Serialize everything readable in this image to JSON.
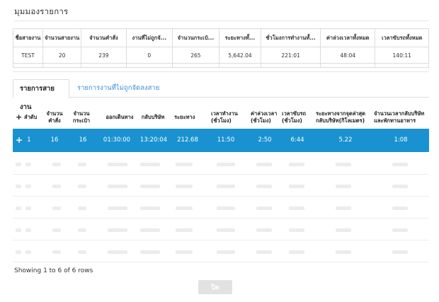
{
  "page": {
    "title": "มุมมองรายการ"
  },
  "summary": {
    "headers": [
      "ชื่อสายงาน",
      "จำนวนสายงาน",
      "จำนวนคำสั่ง",
      "งานที่ไม่ถูกจั...",
      "จำนวนกระเป๋...",
      "ระยะทางทั้...",
      "ชั่วโมงการทำงานทั้...",
      "ค่าล่วงเวลาทั้งหมด",
      "เวลาขับรถทั้งหมด"
    ],
    "values": [
      "TEST",
      "20",
      "239",
      "0",
      "265",
      "5,642.04",
      "221:01",
      "48:04",
      "140:11"
    ]
  },
  "tabs": [
    {
      "label": "รายการสายงาน",
      "active": true
    },
    {
      "label": "รายการงานที่ไม่ถูกจัดลงสาย",
      "active": false
    }
  ],
  "detail": {
    "headers": {
      "plus": "+",
      "seq": "ลำดับ",
      "orders_1": "จำนวน",
      "orders_2": "คำสั่ง",
      "bags_1": "จำนวน",
      "bags_2": "กระเป๋า",
      "depart": "ออกเดินทาง",
      "return": "กลับบริษัท",
      "distance": "ระยะทาง",
      "work_1": "เวลาทำงาน",
      "work_2": "(ชั่วโมง)",
      "ot_1": "ค่าล่วงเวลา",
      "ot_2": "(ชั่วโมง)",
      "drive_1": "เวลาขับรถ",
      "drive_2": "(ชั่วโมง)",
      "last_1": "ระยะทางจากจุดล่าสุด",
      "last_2": "กลับบริษัท(กิโลเมตร)",
      "back_1": "จำนวนเวลากลับบริษัท",
      "back_2": "และพักทานอาหาร"
    },
    "row": {
      "plus": "+",
      "seq": "1",
      "orders": "16",
      "bags": "16",
      "depart": "01:30:00",
      "return": "13:20:04",
      "distance": "212.68",
      "work": "11:50",
      "ot": "2:50",
      "drive": "6:44",
      "last_distance": "5.22",
      "back_time": "1:08"
    }
  },
  "footer": {
    "showing": "Showing 1 to 6 of 6 rows",
    "close_label": "ปิด"
  },
  "colors": {
    "selected_row": "#1a92d1",
    "tab_link": "#3b8fd6",
    "button_disabled": "#e2e2e2"
  }
}
